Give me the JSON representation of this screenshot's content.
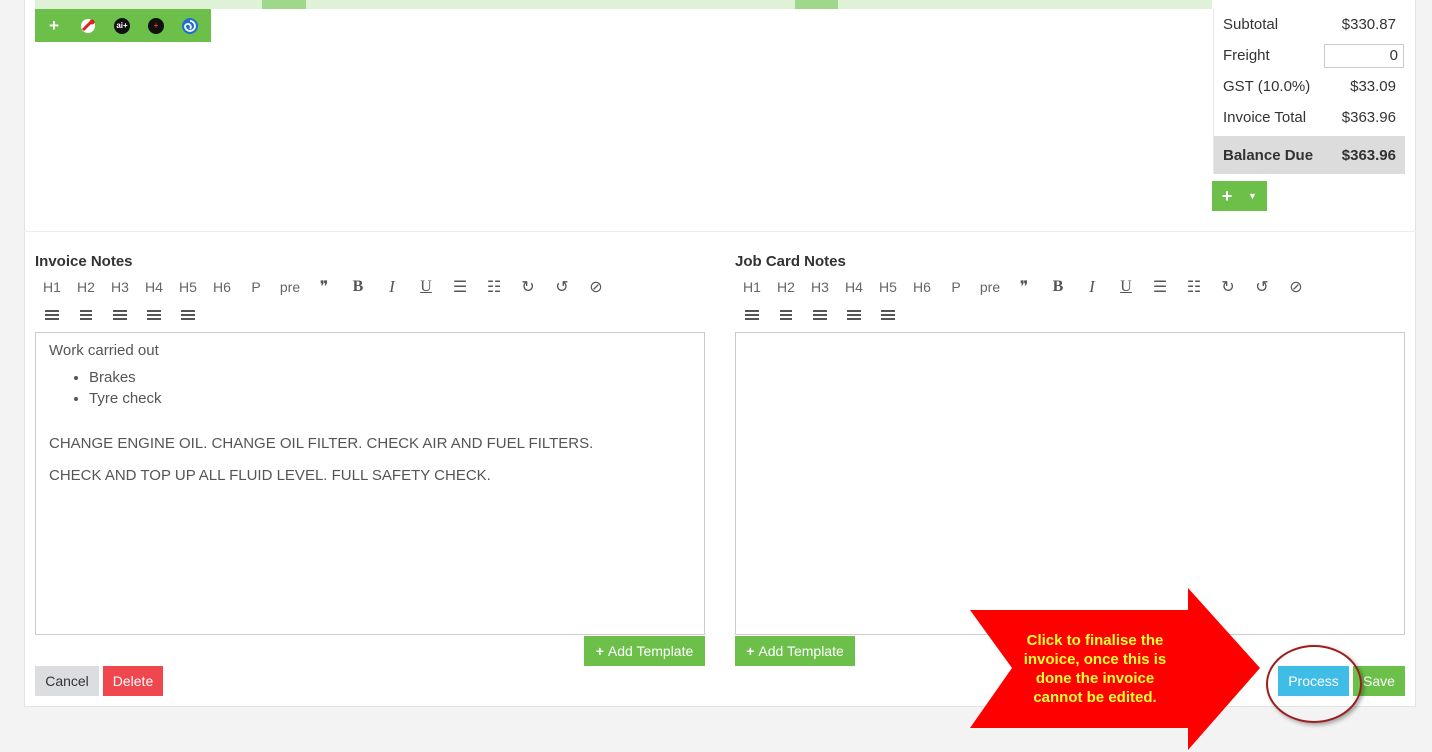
{
  "toolbar_icons": [
    "plus-icon",
    "red-tool-icon",
    "ai-plus-icon",
    "dark-plus-icon",
    "blue-spiral-icon"
  ],
  "toolbar_icon_text": {
    "ai": "ai+",
    "dark": "+"
  },
  "totals": {
    "subtotal_label": "Subtotal",
    "subtotal_value": "$330.87",
    "freight_label": "Freight",
    "freight_value": "0",
    "gst_label": "GST (10.0%)",
    "gst_value": "$33.09",
    "invoice_total_label": "Invoice Total",
    "invoice_total_value": "$363.96",
    "balance_due_label": "Balance Due",
    "balance_due_value": "$363.96"
  },
  "invoice_notes": {
    "label": "Invoice Notes",
    "intro": "Work carried out",
    "bullets": [
      "Brakes",
      "Tyre check"
    ],
    "line1": "CHANGE ENGINE OIL. CHANGE OIL FILTER. CHECK AIR AND FUEL FILTERS.",
    "line2": "CHECK AND TOP UP ALL FLUID LEVEL. FULL SAFETY CHECK.",
    "add_template": "Add Template"
  },
  "job_card_notes": {
    "label": "Job Card Notes",
    "add_template": "Add Template"
  },
  "editor_toolbar": {
    "headings": [
      "H1",
      "H2",
      "H3",
      "H4",
      "H5",
      "H6",
      "P",
      "pre"
    ],
    "quote": "❞",
    "bold": "B",
    "italic": "I",
    "underline": "U",
    "bullets": "☰",
    "numbered": "☷",
    "redo": "↻",
    "undo": "↺",
    "clear": "⊘"
  },
  "actions": {
    "cancel": "Cancel",
    "delete": "Delete",
    "process": "Process",
    "save": "Save"
  },
  "callout": {
    "text": "Click to finalise the invoice, once this is done the invoice cannot be edited."
  },
  "colors": {
    "green": "#6cc04a",
    "blue": "#40bde6",
    "red": "#f0474e",
    "callout_red": "#ff0000",
    "callout_text": "#ffff33"
  }
}
